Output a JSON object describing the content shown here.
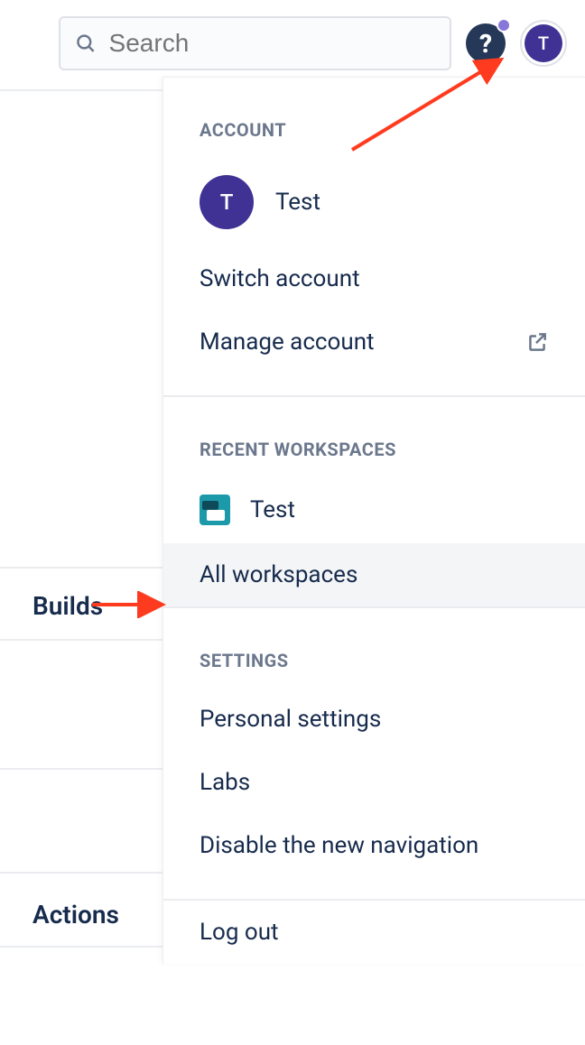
{
  "topbar": {
    "search_placeholder": "Search"
  },
  "avatar": {
    "initial": "T"
  },
  "side": {
    "builds_label": "Builds",
    "actions_label": "Actions"
  },
  "menu": {
    "account_header": "ACCOUNT",
    "account_name": "Test",
    "switch_account": "Switch account",
    "manage_account": "Manage account",
    "recent_workspaces_header": "RECENT WORKSPACES",
    "workspace_test": "Test",
    "all_workspaces": "All workspaces",
    "settings_header": "SETTINGS",
    "personal_settings": "Personal settings",
    "labs": "Labs",
    "disable_nav": "Disable the new navigation",
    "log_out": "Log out"
  }
}
